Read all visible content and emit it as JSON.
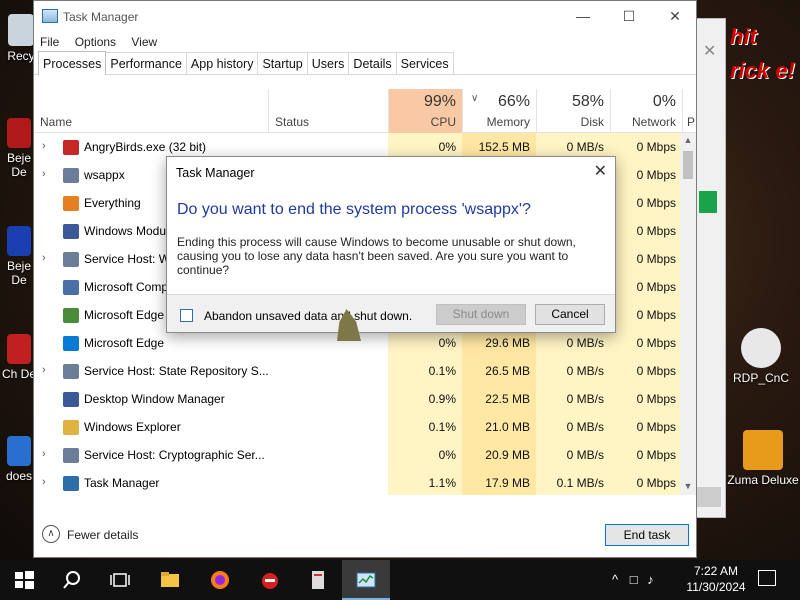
{
  "desktop": {
    "icons": [
      {
        "label": "Recy"
      },
      {
        "label": "Beje De"
      },
      {
        "label": "Beje De"
      },
      {
        "label": "Ch De"
      },
      {
        "label": "does"
      },
      {
        "label": "RDP_CnC"
      },
      {
        "label": "Zuma Deluxe"
      }
    ],
    "banner": "hit rick e!"
  },
  "window": {
    "title": "Task Manager",
    "minimize": "—",
    "maximize": "☐",
    "close": "✕"
  },
  "menu": [
    "File",
    "Options",
    "View"
  ],
  "tabs": [
    "Processes",
    "Performance",
    "App history",
    "Startup",
    "Users",
    "Details",
    "Services"
  ],
  "columns": {
    "name": "Name",
    "status": "Status",
    "cpu": {
      "pct": "99%",
      "label": "CPU"
    },
    "memory": {
      "pct": "66%",
      "label": "Memory"
    },
    "disk": {
      "pct": "58%",
      "label": "Disk"
    },
    "network": {
      "pct": "0%",
      "label": "Network"
    },
    "power": "P"
  },
  "processes": [
    {
      "name": "AngryBirds.exe (32 bit)",
      "cpu": "0%",
      "memory": "152.5 MB",
      "disk": "0 MB/s",
      "network": "0 Mbps",
      "expand": "›"
    },
    {
      "name": "wsappx",
      "cpu": "",
      "memory": "",
      "disk": "",
      "network": "0 Mbps",
      "expand": "›"
    },
    {
      "name": "Everything",
      "cpu": "",
      "memory": "",
      "disk": "",
      "network": "0 Mbps",
      "expand": ""
    },
    {
      "name": "Windows Modu",
      "cpu": "",
      "memory": "",
      "disk": "",
      "network": "0 Mbps",
      "expand": ""
    },
    {
      "name": "Service Host: W",
      "cpu": "",
      "memory": "",
      "disk": "",
      "network": "0 Mbps",
      "expand": "›"
    },
    {
      "name": "Microsoft Comp",
      "cpu": "",
      "memory": "",
      "disk": "",
      "network": "0 Mbps",
      "expand": ""
    },
    {
      "name": "Microsoft Edge",
      "cpu": "",
      "memory": "",
      "disk": "",
      "network": "0 Mbps",
      "expand": ""
    },
    {
      "name": "Microsoft Edge",
      "cpu": "0%",
      "memory": "29.6 MB",
      "disk": "0 MB/s",
      "network": "0 Mbps",
      "expand": ""
    },
    {
      "name": "Service Host: State Repository S...",
      "cpu": "0.1%",
      "memory": "26.5 MB",
      "disk": "0 MB/s",
      "network": "0 Mbps",
      "expand": "›"
    },
    {
      "name": "Desktop Window Manager",
      "cpu": "0.9%",
      "memory": "22.5 MB",
      "disk": "0 MB/s",
      "network": "0 Mbps",
      "expand": ""
    },
    {
      "name": "Windows Explorer",
      "cpu": "0.1%",
      "memory": "21.0 MB",
      "disk": "0 MB/s",
      "network": "0 Mbps",
      "expand": ""
    },
    {
      "name": "Service Host: Cryptographic Ser...",
      "cpu": "0%",
      "memory": "20.9 MB",
      "disk": "0 MB/s",
      "network": "0 Mbps",
      "expand": "›"
    },
    {
      "name": "Task Manager",
      "cpu": "1.1%",
      "memory": "17.9 MB",
      "disk": "0.1 MB/s",
      "network": "0 Mbps",
      "expand": "›"
    }
  ],
  "footer": {
    "fewer_details": "Fewer details",
    "end_task": "End task"
  },
  "dialog": {
    "title": "Task Manager",
    "close": "✕",
    "heading": "Do you want to end the system process 'wsappx'?",
    "body": "Ending this process will cause Windows to become unusable or shut down, causing you to lose any data hasn't been saved. Are you sure you want to continue?",
    "checkbox_label": "Abandon unsaved data and shut down.",
    "shutdown_label": "Shut down",
    "cancel_label": "Cancel"
  },
  "taskbar": {
    "clock_time": "7:22 AM",
    "clock_date": "11/30/2024",
    "tray_chevron": "^"
  }
}
